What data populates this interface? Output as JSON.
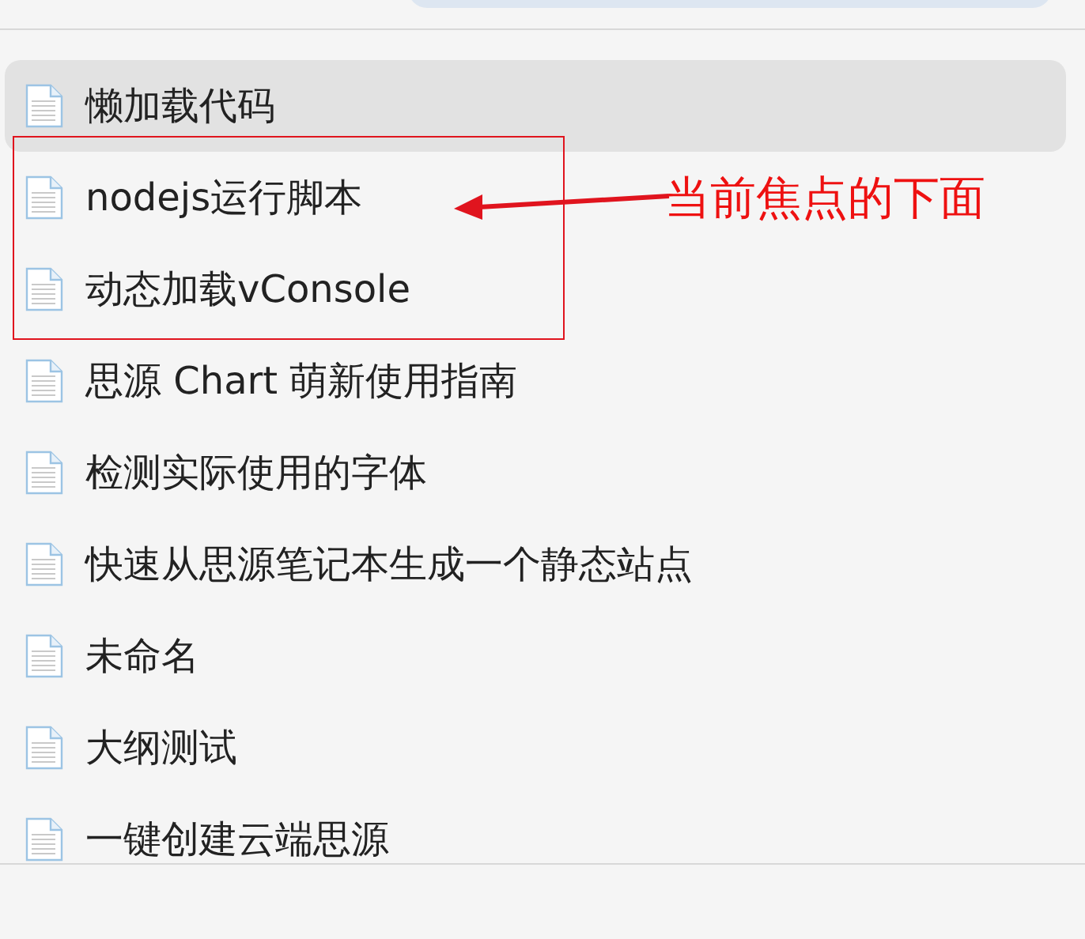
{
  "documents": [
    {
      "title": "懒加载代码",
      "selected": true
    },
    {
      "title": "nodejs运行脚本",
      "selected": false
    },
    {
      "title": "动态加载vConsole",
      "selected": false
    },
    {
      "title": "思源 Chart 萌新使用指南",
      "selected": false
    },
    {
      "title": "检测实际使用的字体",
      "selected": false
    },
    {
      "title": "快速从思源笔记本生成一个静态站点",
      "selected": false
    },
    {
      "title": "未命名",
      "selected": false
    },
    {
      "title": "大纲测试",
      "selected": false
    },
    {
      "title": "一键创建云端思源",
      "selected": false
    }
  ],
  "annotation": {
    "text": "当前焦点的下面"
  }
}
